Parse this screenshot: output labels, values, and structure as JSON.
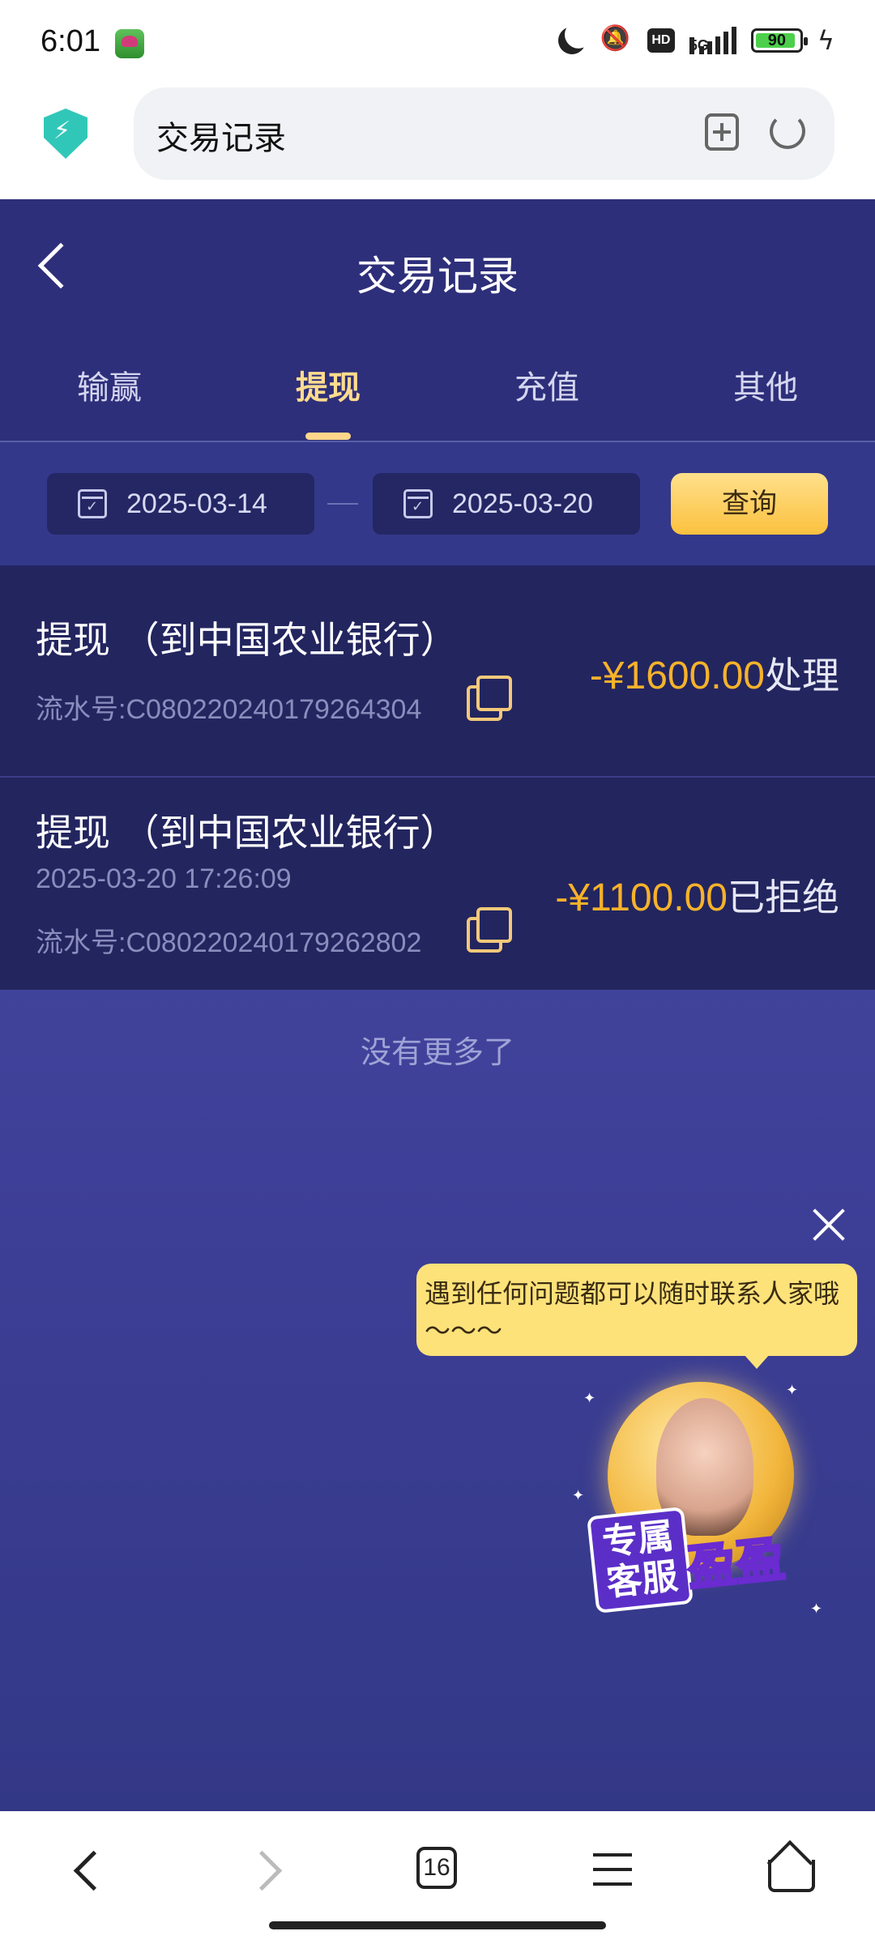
{
  "status_bar": {
    "time": "6:01",
    "network": "5G",
    "hd_label": "HD",
    "battery": "90",
    "icons": [
      "moon-icon",
      "mute-icon",
      "hd-icon",
      "signal-icon",
      "battery-icon",
      "charging-icon"
    ]
  },
  "browser": {
    "url_title": "交易记录",
    "icons": [
      "shield-icon",
      "add-bookmark-icon",
      "reload-icon"
    ]
  },
  "header": {
    "title": "交易记录",
    "back_icon": "back-arrow-icon"
  },
  "tabs": [
    {
      "label": "输赢",
      "active": false
    },
    {
      "label": "提现",
      "active": true
    },
    {
      "label": "充值",
      "active": false
    },
    {
      "label": "其他",
      "active": false
    }
  ],
  "filter": {
    "start_date": "2025-03-14",
    "end_date": "2025-03-20",
    "query_label": "查询"
  },
  "records": [
    {
      "title": "提现 （到中国农业银行）",
      "serial": "流水号:C080220240179264304",
      "amount": "-¥1600.00",
      "status": "处理"
    },
    {
      "title": "提现 （到中国农业银行）",
      "time": "2025-03-20 17:26:09",
      "serial": "流水号:C080220240179262802",
      "amount": "-¥1100.00",
      "status": "已拒绝"
    }
  ],
  "no_more": "没有更多了",
  "support": {
    "bubble_text": "遇到任何问题都可以随时联系人家哦～～～",
    "badge_label1": "专属客服",
    "badge_label2": "盈盈"
  },
  "bottom_nav": {
    "tab_count": "16",
    "icons": [
      "back-icon",
      "forward-icon",
      "tabs-icon",
      "menu-icon",
      "home-icon"
    ]
  },
  "colors": {
    "header_bg": "#2e2f7a",
    "accent_gold": "#f7b22a",
    "active_tab": "#ffdc8e"
  }
}
